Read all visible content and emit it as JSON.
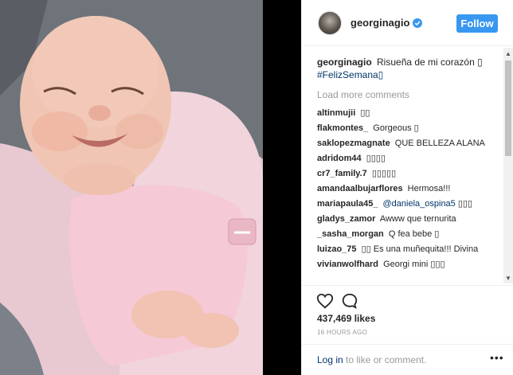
{
  "post": {
    "username": "georginagio",
    "follow_label": "Follow",
    "media_alt": "Smiling baby wrapped in a pink blanket"
  },
  "caption": {
    "username": "georginagio",
    "text": "Risueña de mi corazón ▯",
    "hashtag": "#FelizSemana▯"
  },
  "load_more_label": "Load more comments",
  "comments": [
    {
      "user": "altinmujii",
      "text": "▯▯"
    },
    {
      "user": "flakmontes_",
      "text": "Gorgeous ▯"
    },
    {
      "user": "saklopezmagnate",
      "text": "QUE BELLEZA ALANA"
    },
    {
      "user": "adridom44",
      "text": "▯▯▯▯"
    },
    {
      "user": "cr7_family.7",
      "text": "▯▯▯▯▯"
    },
    {
      "user": "amandaalbujarflores",
      "text": "Hermosa!!!"
    },
    {
      "user": "mariapaula45_",
      "mention": "@daniela_ospina5",
      "text": "▯▯▯"
    },
    {
      "user": "gladys_zamor",
      "text": "Awww que ternurita"
    },
    {
      "user": "_sasha_morgan",
      "text": "Q fea bebe ▯"
    },
    {
      "user": "luizao_75",
      "text": "▯▯ Es una muñequita!!! Divina"
    },
    {
      "user": "vivianwolfhard",
      "text": "Georgi mini ▯▯▯"
    }
  ],
  "likes": "437,469 likes",
  "timestamp": "16 HOURS AGO",
  "footer": {
    "login_label": "Log in",
    "rest_label": " to like or comment.",
    "more_label": "•••"
  },
  "icons": {
    "heart": "heart-icon",
    "comment": "comment-icon",
    "verified": "verified-badge-icon"
  },
  "colors": {
    "accent": "#3897f0",
    "link": "#003569",
    "muted": "#999999",
    "text": "#262626"
  }
}
